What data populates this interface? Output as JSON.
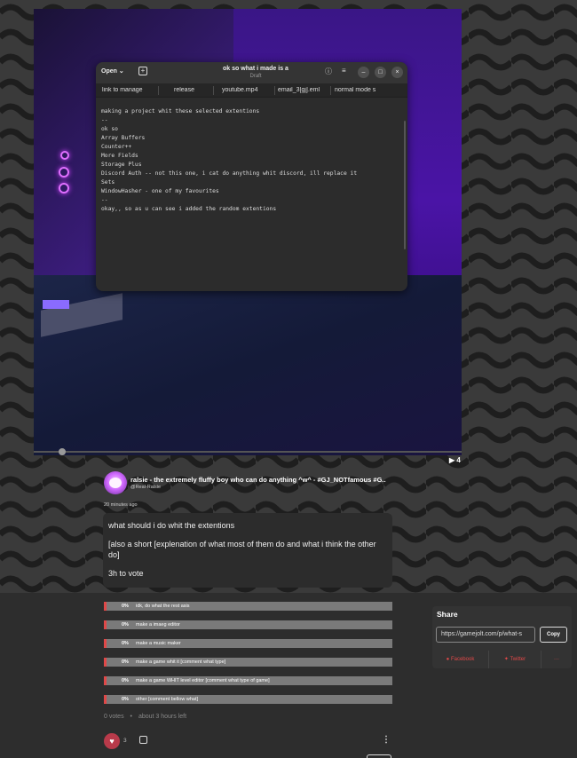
{
  "media": {
    "window": {
      "open_label": "Open",
      "title": "ok so what i made is a",
      "subtitle": "Draft",
      "tabs": [
        "link to manage",
        "release",
        "youtube.mp4",
        "email_3[gj].eml",
        "normal mode s"
      ],
      "lines": [
        "making a project whit these selected extentions",
        "--",
        "ok so",
        "Array Buffers",
        "Counter++",
        "More Fields",
        "Storage Plus",
        "Discord Auth -- not this one, i cat do anything whit discord, ill replace it",
        "Sets",
        "WindowHasher - one of my favourites",
        "--",
        "okay,, so as u can see i added the random extentions"
      ]
    },
    "play_count": "▶ 4"
  },
  "post": {
    "author": "ralsie - the extremely fluffy boy who can do anything ^w^ - #GJ_NOTfamous #G..",
    "handle": "@Real-Ralsie",
    "time": "20 minutes ago",
    "body": [
      "what should i do whit the extentions",
      "[also a short [explenation of what most of them do and what i think the other do]",
      "3h to vote"
    ]
  },
  "poll": {
    "options": [
      {
        "pct": "0%",
        "text": "idk, do what the rest asis"
      },
      {
        "pct": "0%",
        "text": "make a imaeg editor"
      },
      {
        "pct": "0%",
        "text": "make a music maker"
      },
      {
        "pct": "0%",
        "text": "make a game whit it [comment what type]"
      },
      {
        "pct": "0%",
        "text": "make a game WHIT level editor [comment what type of game]"
      },
      {
        "pct": "0%",
        "text": "other [comment bellow what]"
      }
    ],
    "votes": "0 votes",
    "separator": "•",
    "time_left": "about 3 hours left"
  },
  "actions": {
    "like_count": "3"
  },
  "share": {
    "heading": "Share",
    "url": "https://gamejolt.com/p/what-s",
    "copy_label": "Copy",
    "facebook": "Facebook",
    "twitter": "Twitter",
    "more": "···"
  },
  "colors": {
    "accent": "#e04848",
    "poll_bar": "#7a7a7a",
    "bg": "#2b2b2b"
  }
}
